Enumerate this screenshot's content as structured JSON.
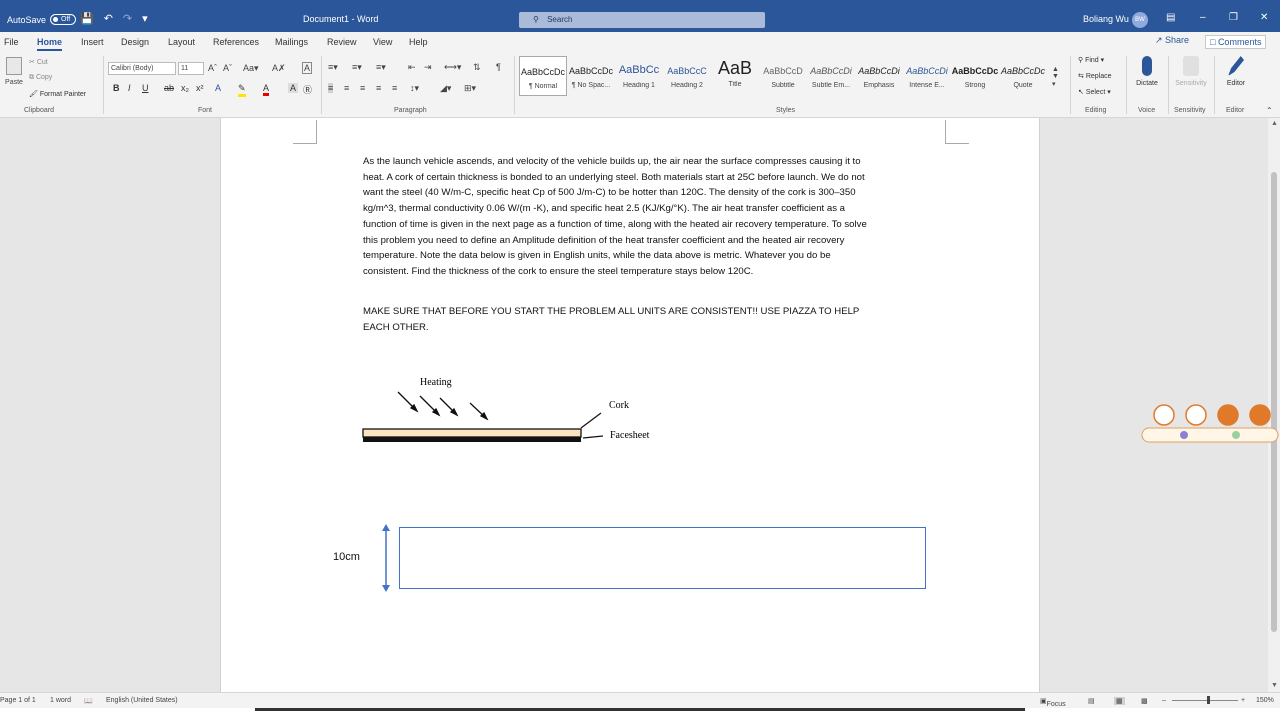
{
  "titlebar": {
    "autosave_label": "AutoSave",
    "autosave_state": "Off",
    "doc_title": "Document1  -  Word",
    "search_placeholder": "Search",
    "user_name": "Boliang Wu",
    "user_initials": "BW"
  },
  "menu": {
    "tabs": [
      "File",
      "Home",
      "Insert",
      "Design",
      "Layout",
      "References",
      "Mailings",
      "Review",
      "View",
      "Help"
    ],
    "active": "Home",
    "share": "Share",
    "comments": "Comments"
  },
  "ribbon": {
    "clipboard": {
      "paste": "Paste",
      "cut": "Cut",
      "copy": "Copy",
      "format_painter": "Format Painter",
      "label": "Clipboard"
    },
    "font": {
      "name": "Calibri (Body)",
      "size": "11",
      "label": "Font"
    },
    "paragraph": {
      "label": "Paragraph"
    },
    "styles": {
      "label": "Styles",
      "items": [
        {
          "sample": "AaBbCcDc",
          "name": "¶ Normal"
        },
        {
          "sample": "AaBbCcDc",
          "name": "¶ No Spac..."
        },
        {
          "sample": "AaBbCc",
          "name": "Heading 1"
        },
        {
          "sample": "AaBbCcC",
          "name": "Heading 2"
        },
        {
          "sample": "AaB",
          "name": "Title"
        },
        {
          "sample": "AaBbCcD",
          "name": "Subtitle"
        },
        {
          "sample": "AaBbCcDi",
          "name": "Subtle Em..."
        },
        {
          "sample": "AaBbCcDi",
          "name": "Emphasis"
        },
        {
          "sample": "AaBbCcDi",
          "name": "Intense E..."
        },
        {
          "sample": "AaBbCcDc",
          "name": "Strong"
        },
        {
          "sample": "AaBbCcDc",
          "name": "Quote"
        }
      ]
    },
    "editing": {
      "find": "Find",
      "replace": "Replace",
      "select": "Select",
      "label": "Editing"
    },
    "voice": {
      "dictate": "Dictate",
      "label": "Voice"
    },
    "sensitivity": {
      "button": "Sensitivity",
      "label": "Sensitivity"
    },
    "editor": {
      "button": "Editor",
      "label": "Editor"
    }
  },
  "document": {
    "paragraph1": "As the launch vehicle ascends, and velocity of the vehicle builds up, the air near the surface compresses causing it to heat. A cork of certain thickness is bonded to an underlying steel. Both materials start at 25C before launch. We do not want the steel (40 W/m-C, specific heat Cp of 500 J/m-C) to be hotter than 120C.  The density of the cork is 300–350 kg/m^3, thermal conductivity 0.06 W/(m -K),  and specific heat 2.5 (KJ/Kg/°K). The air heat transfer coefficient as a function of time is given in the next page as a function of time, along with the heated air recovery temperature. To solve this problem you need to define an Amplitude definition of the heat transfer coefficient and the heated air recovery temperature. Note the data below is given in English units, while the data above is metric. Whatever you do be consistent. Find the thickness of the cork to ensure the steel temperature stays below 120C.",
    "paragraph2": "MAKE SURE THAT BEFORE YOU START THE PROBLEM ALL UNITS ARE CONSISTENT!! USE PIAZZA TO HELP EACH OTHER.",
    "figure": {
      "heating": "Heating",
      "cork": "Cork",
      "facesheet": "Facesheet"
    },
    "dimension_label": "10cm"
  },
  "status": {
    "page": "Page 1 of 1",
    "words": "1 word",
    "language": "English (United States)",
    "focus": "Focus",
    "zoom": "150%"
  },
  "colors": {
    "accent": "#2b579a",
    "cork": "#fbe5c0",
    "box_border": "#4472c4"
  }
}
